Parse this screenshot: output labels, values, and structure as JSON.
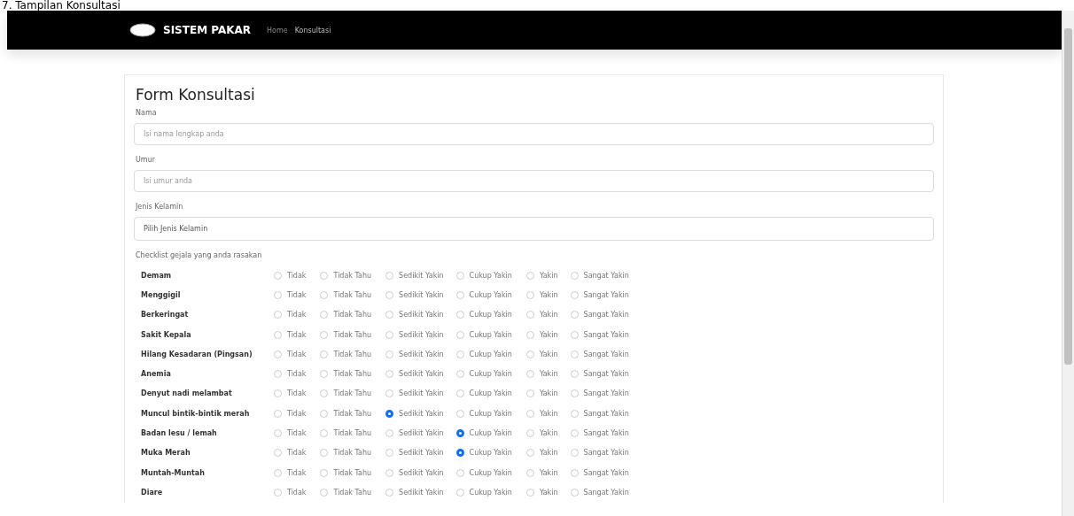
{
  "caption": "7. Tampilan Konsultasi",
  "navbar": {
    "brand": "SISTEM PAKAR",
    "links": [
      {
        "label": "Home",
        "selected": false
      },
      {
        "label": "Konsultasi",
        "selected": true
      }
    ]
  },
  "form": {
    "title": "Form Konsultasi",
    "fields": [
      {
        "label": "Nama",
        "kind": "input",
        "placeholder": "Isi nama lengkap anda"
      },
      {
        "label": "Umur",
        "kind": "input",
        "placeholder": "Isi umur anda"
      },
      {
        "label": "Jenis Kelamin",
        "kind": "select",
        "value": "Pilih Jenis Kelamin"
      }
    ],
    "checklist_label": "Checklist gejala yang anda rasakan",
    "symptoms": [
      {
        "name": "Demam",
        "options": [
          {
            "label": "Tidak",
            "selected": false
          },
          {
            "label": "Tidak Tahu",
            "selected": false
          },
          {
            "label": "Sedikit Yakin",
            "selected": false
          },
          {
            "label": "Cukup Yakin",
            "selected": false
          },
          {
            "label": "Yakin",
            "selected": false
          },
          {
            "label": "Sangat Yakin",
            "selected": false
          }
        ]
      },
      {
        "name": "Menggigil",
        "options": [
          {
            "label": "Tidak",
            "selected": false
          },
          {
            "label": "Tidak Tahu",
            "selected": false
          },
          {
            "label": "Sedikit Yakin",
            "selected": false
          },
          {
            "label": "Cukup Yakin",
            "selected": false
          },
          {
            "label": "Yakin",
            "selected": false
          },
          {
            "label": "Sangat Yakin",
            "selected": false
          }
        ]
      },
      {
        "name": "Berkeringat",
        "options": [
          {
            "label": "Tidak",
            "selected": false
          },
          {
            "label": "Tidak Tahu",
            "selected": false
          },
          {
            "label": "Sedikit Yakin",
            "selected": false
          },
          {
            "label": "Cukup Yakin",
            "selected": false
          },
          {
            "label": "Yakin",
            "selected": false
          },
          {
            "label": "Sangat Yakin",
            "selected": false
          }
        ]
      },
      {
        "name": "Sakit Kepala",
        "options": [
          {
            "label": "Tidak",
            "selected": false
          },
          {
            "label": "Tidak Tahu",
            "selected": false
          },
          {
            "label": "Sedikit Yakin",
            "selected": false
          },
          {
            "label": "Cukup Yakin",
            "selected": false
          },
          {
            "label": "Yakin",
            "selected": false
          },
          {
            "label": "Sangat Yakin",
            "selected": false
          }
        ]
      },
      {
        "name": "Hilang Kesadaran (Pingsan)",
        "options": [
          {
            "label": "Tidak",
            "selected": false
          },
          {
            "label": "Tidak Tahu",
            "selected": false
          },
          {
            "label": "Sedikit Yakin",
            "selected": false
          },
          {
            "label": "Cukup Yakin",
            "selected": false
          },
          {
            "label": "Yakin",
            "selected": false
          },
          {
            "label": "Sangat Yakin",
            "selected": false
          }
        ]
      },
      {
        "name": "Anemia",
        "options": [
          {
            "label": "Tidak",
            "selected": false
          },
          {
            "label": "Tidak Tahu",
            "selected": false
          },
          {
            "label": "Sedikit Yakin",
            "selected": false
          },
          {
            "label": "Cukup Yakin",
            "selected": false
          },
          {
            "label": "Yakin",
            "selected": false
          },
          {
            "label": "Sangat Yakin",
            "selected": false
          }
        ]
      },
      {
        "name": "Denyut nadi melambat",
        "options": [
          {
            "label": "Tidak",
            "selected": false
          },
          {
            "label": "Tidak Tahu",
            "selected": false
          },
          {
            "label": "Sedikit Yakin",
            "selected": false
          },
          {
            "label": "Cukup Yakin",
            "selected": false
          },
          {
            "label": "Yakin",
            "selected": false
          },
          {
            "label": "Sangat Yakin",
            "selected": false
          }
        ]
      },
      {
        "name": "Muncul bintik-bintik merah",
        "options": [
          {
            "label": "Tidak",
            "selected": false
          },
          {
            "label": "Tidak Tahu",
            "selected": false
          },
          {
            "label": "Sedikit Yakin",
            "selected": true
          },
          {
            "label": "Cukup Yakin",
            "selected": false
          },
          {
            "label": "Yakin",
            "selected": false
          },
          {
            "label": "Sangat Yakin",
            "selected": false
          }
        ]
      },
      {
        "name": "Badan lesu / lemah",
        "options": [
          {
            "label": "Tidak",
            "selected": false
          },
          {
            "label": "Tidak Tahu",
            "selected": false
          },
          {
            "label": "Sedikit Yakin",
            "selected": false
          },
          {
            "label": "Cukup Yakin",
            "selected": true
          },
          {
            "label": "Yakin",
            "selected": false
          },
          {
            "label": "Sangat Yakin",
            "selected": false
          }
        ]
      },
      {
        "name": "Muka Merah",
        "options": [
          {
            "label": "Tidak",
            "selected": false
          },
          {
            "label": "Tidak Tahu",
            "selected": false
          },
          {
            "label": "Sedikit Yakin",
            "selected": false
          },
          {
            "label": "Cukup Yakin",
            "selected": true
          },
          {
            "label": "Yakin",
            "selected": false
          },
          {
            "label": "Sangat Yakin",
            "selected": false
          }
        ]
      },
      {
        "name": "Muntah-Muntah",
        "options": [
          {
            "label": "Tidak",
            "selected": false
          },
          {
            "label": "Tidak Tahu",
            "selected": false
          },
          {
            "label": "Sedikit Yakin",
            "selected": false
          },
          {
            "label": "Cukup Yakin",
            "selected": false
          },
          {
            "label": "Yakin",
            "selected": false
          },
          {
            "label": "Sangat Yakin",
            "selected": false
          }
        ]
      },
      {
        "name": "Diare",
        "options": [
          {
            "label": "Tidak",
            "selected": false
          },
          {
            "label": "Tidak Tahu",
            "selected": false
          },
          {
            "label": "Sedikit Yakin",
            "selected": false
          },
          {
            "label": "Cukup Yakin",
            "selected": false
          },
          {
            "label": "Yakin",
            "selected": false
          },
          {
            "label": "Sangat Yakin",
            "selected": false
          }
        ]
      }
    ]
  }
}
